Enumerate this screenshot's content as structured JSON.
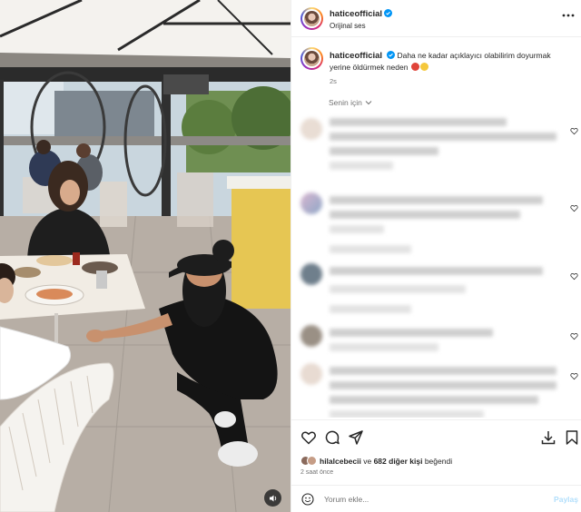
{
  "post": {
    "username": "haticeofficial",
    "verified": true,
    "audio": "Orijinal ses"
  },
  "caption": {
    "username": "haticeofficial",
    "text": "Daha ne kadar açıklayıcı olabilirim doyurmak yerine öldürmek neden",
    "time": "2s"
  },
  "comments": {
    "filter_label": "Senin için",
    "blurred": true
  },
  "actions": {
    "icons": [
      "heart-icon",
      "comment-icon",
      "share-icon",
      "save-icon",
      "bookmark-icon"
    ]
  },
  "likes": {
    "liker": "hilalcebecii",
    "connector": "ve",
    "others": "682 diğer kişi",
    "suffix": "beğendi"
  },
  "time_ago": "2 saat önce",
  "composer": {
    "placeholder": "Yorum ekle...",
    "post_label": "Paylaş"
  },
  "colors": {
    "verified": "#0095f6",
    "post_disabled": "#b2dffc",
    "muted_text": "#737373"
  }
}
